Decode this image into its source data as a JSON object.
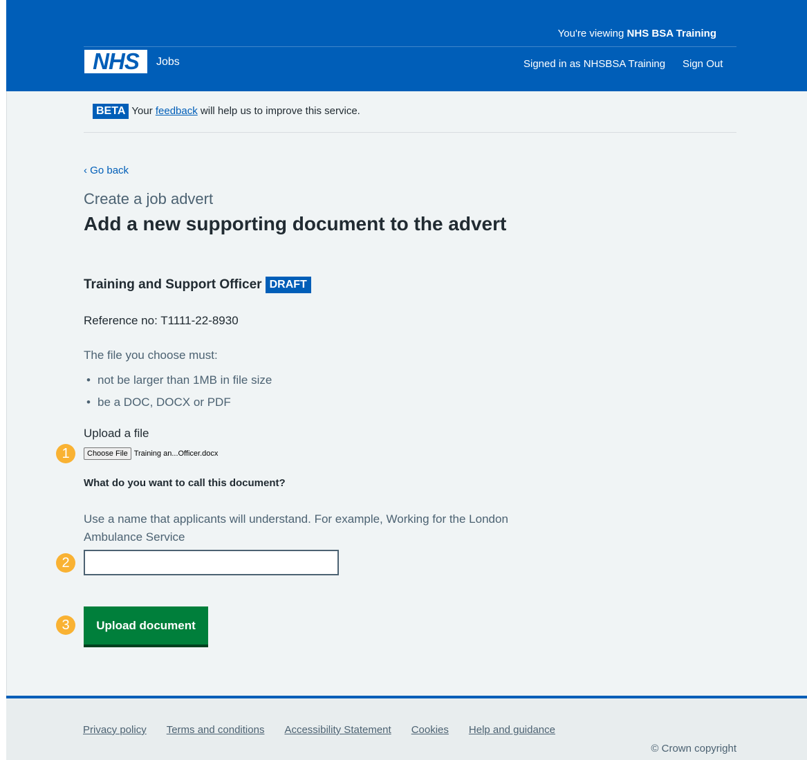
{
  "header": {
    "viewing_prefix": "You're viewing ",
    "viewing_org": "NHS BSA Training",
    "logo": "NHS",
    "service_name": "Jobs",
    "signed_in": "Signed in as NHSBSA Training",
    "sign_out": "Sign Out"
  },
  "beta": {
    "tag": "BETA",
    "text_before": "Your ",
    "link": "feedback",
    "text_after": " will help us to improve this service."
  },
  "nav": {
    "back": "Go back"
  },
  "page": {
    "caption": "Create a job advert",
    "title": "Add a new supporting document to the advert",
    "job_title": "Training and Support Officer",
    "status_tag": "DRAFT",
    "reference": "Reference no: T1111-22-8930",
    "file_intro": "The file you choose must:",
    "file_rules": [
      "not be larger than 1MB in file size",
      "be a DOC, DOCX or PDF"
    ],
    "upload_label": "Upload a file",
    "choose_file_label": "Choose File",
    "chosen_file": "Training an...Officer.docx",
    "question": "What do you want to call this document?",
    "hint": "Use a name that applicants will understand. For example, Working for the London Ambulance Service",
    "document_name_value": "",
    "submit": "Upload document"
  },
  "markers": [
    "1",
    "2",
    "3"
  ],
  "footer": {
    "links": [
      "Privacy policy",
      "Terms and conditions",
      "Accessibility Statement",
      "Cookies",
      "Help and guidance"
    ],
    "copyright": "© Crown copyright"
  },
  "colors": {
    "nhs_blue": "#005eb8",
    "button_green": "#007f3b",
    "marker_amber": "#f9b233",
    "background": "#f0f4f5"
  }
}
